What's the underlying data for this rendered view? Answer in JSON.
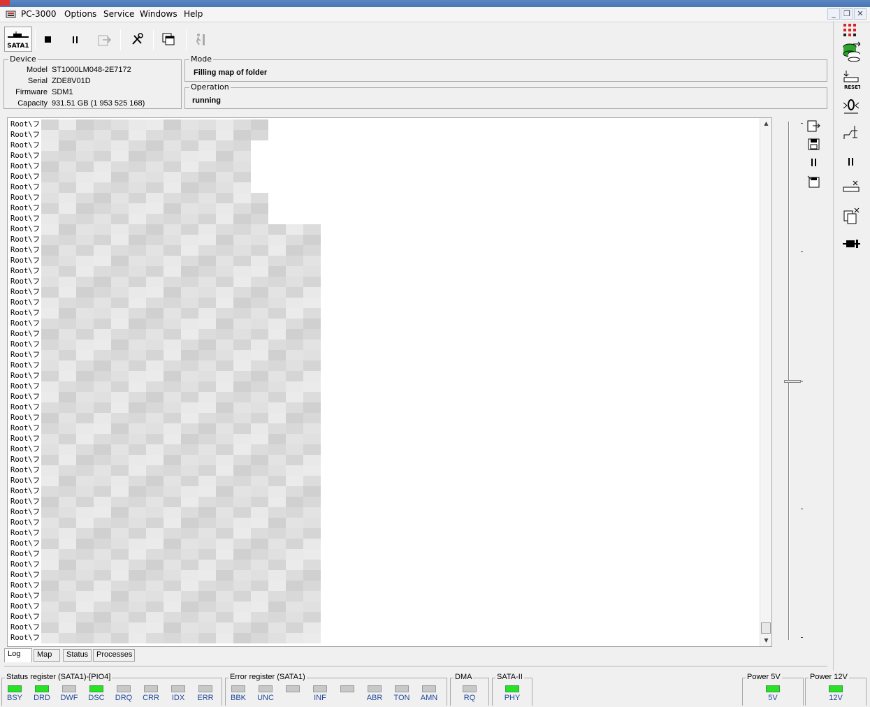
{
  "window": {
    "title": "PC-3000",
    "menu": [
      "Options",
      "Service",
      "Windows",
      "Help"
    ],
    "controls": {
      "minimize": "_",
      "restore": "❐",
      "close": "✕"
    }
  },
  "toolbar": {
    "port_label": "SATA1",
    "icons": [
      "stop-icon",
      "pause-icon",
      "export-icon",
      "tools-icon",
      "windows-icon",
      "exit-icon"
    ]
  },
  "device": {
    "group_title": "Device",
    "labels": {
      "model": "Model",
      "serial": "Serial",
      "firmware": "Firmware",
      "capacity": "Capacity"
    },
    "model": "ST1000LM048-2E7172",
    "serial": "ZDE8V01D",
    "firmware": "SDM1",
    "capacity": "931.51 GB (1 953 525 168)"
  },
  "mode": {
    "title": "Mode",
    "value": "Filling map of folder"
  },
  "operation": {
    "title": "Operation",
    "value": "running"
  },
  "log": {
    "line_prefix": "Root\\フ",
    "line_count": 50
  },
  "tabs": [
    "Log",
    "Map",
    "Status",
    "Processes"
  ],
  "active_tab": "Log",
  "status_register": {
    "title": "Status register (SATA1)-[PIO4]",
    "flags": [
      {
        "label": "BSY",
        "on": true
      },
      {
        "label": "DRD",
        "on": true
      },
      {
        "label": "DWF",
        "on": false
      },
      {
        "label": "DSC",
        "on": true
      },
      {
        "label": "DRQ",
        "on": false
      },
      {
        "label": "CRR",
        "on": false
      },
      {
        "label": "IDX",
        "on": false
      },
      {
        "label": "ERR",
        "on": false
      }
    ]
  },
  "error_register": {
    "title": "Error register (SATA1)",
    "flags": [
      {
        "label": "BBK",
        "on": false
      },
      {
        "label": "UNC",
        "on": false
      },
      {
        "label": "",
        "on": false
      },
      {
        "label": "INF",
        "on": false
      },
      {
        "label": "",
        "on": false
      },
      {
        "label": "ABR",
        "on": false
      },
      {
        "label": "TON",
        "on": false
      },
      {
        "label": "AMN",
        "on": false
      }
    ]
  },
  "dma": {
    "title": "DMA",
    "flag": {
      "label": "RQ",
      "on": false
    }
  },
  "sata2": {
    "title": "SATA-II",
    "flag": {
      "label": "PHY",
      "on": true
    }
  },
  "power5": {
    "title": "Power 5V",
    "flag": {
      "label": "5V",
      "on": true
    }
  },
  "power12": {
    "title": "Power 12V",
    "flag": {
      "label": "12V",
      "on": true
    }
  },
  "colors": {
    "led_on": "#27e227",
    "led_off": "#c8c8c8",
    "flag_text": "#20479b"
  }
}
